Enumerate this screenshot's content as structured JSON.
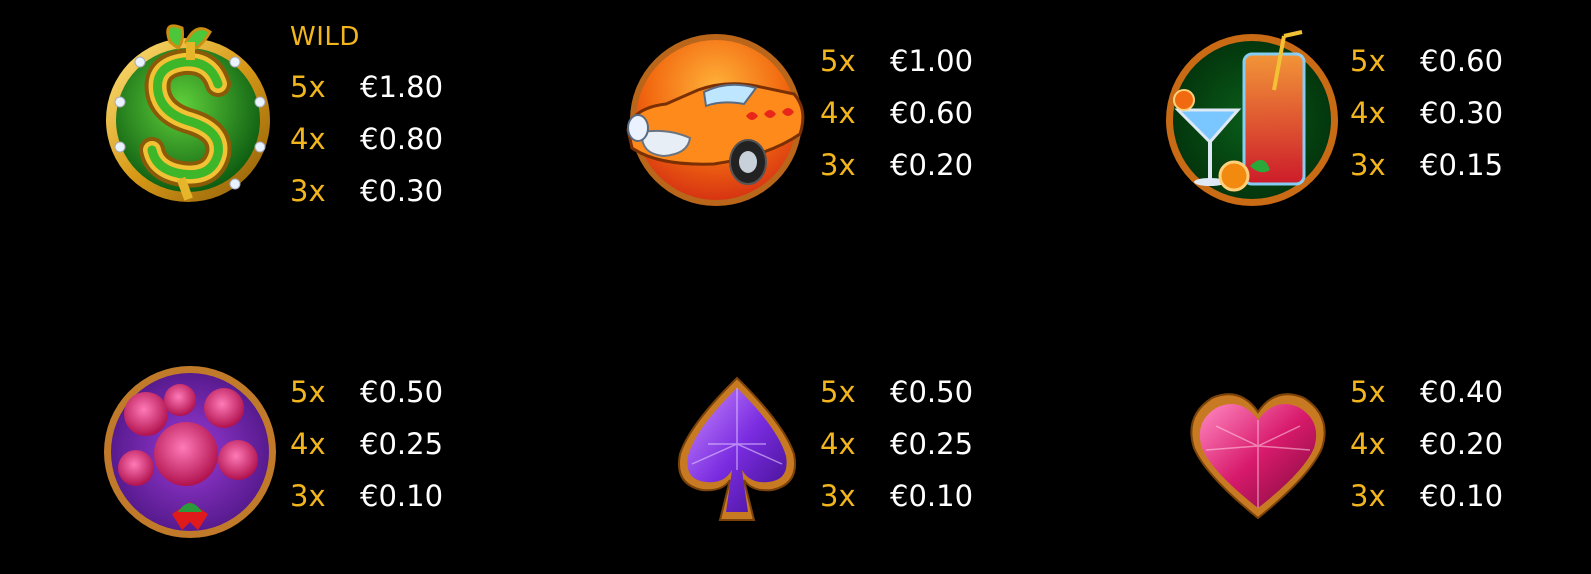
{
  "paytable": {
    "symbols": [
      {
        "id": "wild",
        "icon": "dollar-wild-icon",
        "label": "WILD",
        "pays": [
          {
            "mult": "5x",
            "value": "€1.80"
          },
          {
            "mult": "4x",
            "value": "€0.80"
          },
          {
            "mult": "3x",
            "value": "€0.30"
          }
        ]
      },
      {
        "id": "car",
        "icon": "car-icon",
        "label": "",
        "pays": [
          {
            "mult": "5x",
            "value": "€1.00"
          },
          {
            "mult": "4x",
            "value": "€0.60"
          },
          {
            "mult": "3x",
            "value": "€0.20"
          }
        ]
      },
      {
        "id": "cocktail",
        "icon": "cocktail-icon",
        "label": "",
        "pays": [
          {
            "mult": "5x",
            "value": "€0.60"
          },
          {
            "mult": "4x",
            "value": "€0.30"
          },
          {
            "mult": "3x",
            "value": "€0.15"
          }
        ]
      },
      {
        "id": "roses",
        "icon": "roses-icon",
        "label": "",
        "pays": [
          {
            "mult": "5x",
            "value": "€0.50"
          },
          {
            "mult": "4x",
            "value": "€0.25"
          },
          {
            "mult": "3x",
            "value": "€0.10"
          }
        ]
      },
      {
        "id": "spade",
        "icon": "spade-gem-icon",
        "label": "",
        "pays": [
          {
            "mult": "5x",
            "value": "€0.50"
          },
          {
            "mult": "4x",
            "value": "€0.25"
          },
          {
            "mult": "3x",
            "value": "€0.10"
          }
        ]
      },
      {
        "id": "heart",
        "icon": "heart-gem-icon",
        "label": "",
        "pays": [
          {
            "mult": "5x",
            "value": "€0.40"
          },
          {
            "mult": "4x",
            "value": "€0.20"
          },
          {
            "mult": "3x",
            "value": "€0.10"
          }
        ]
      }
    ],
    "colors": {
      "multiplier": "#f2b51d",
      "value": "#ffffff",
      "background": "#000000"
    }
  }
}
